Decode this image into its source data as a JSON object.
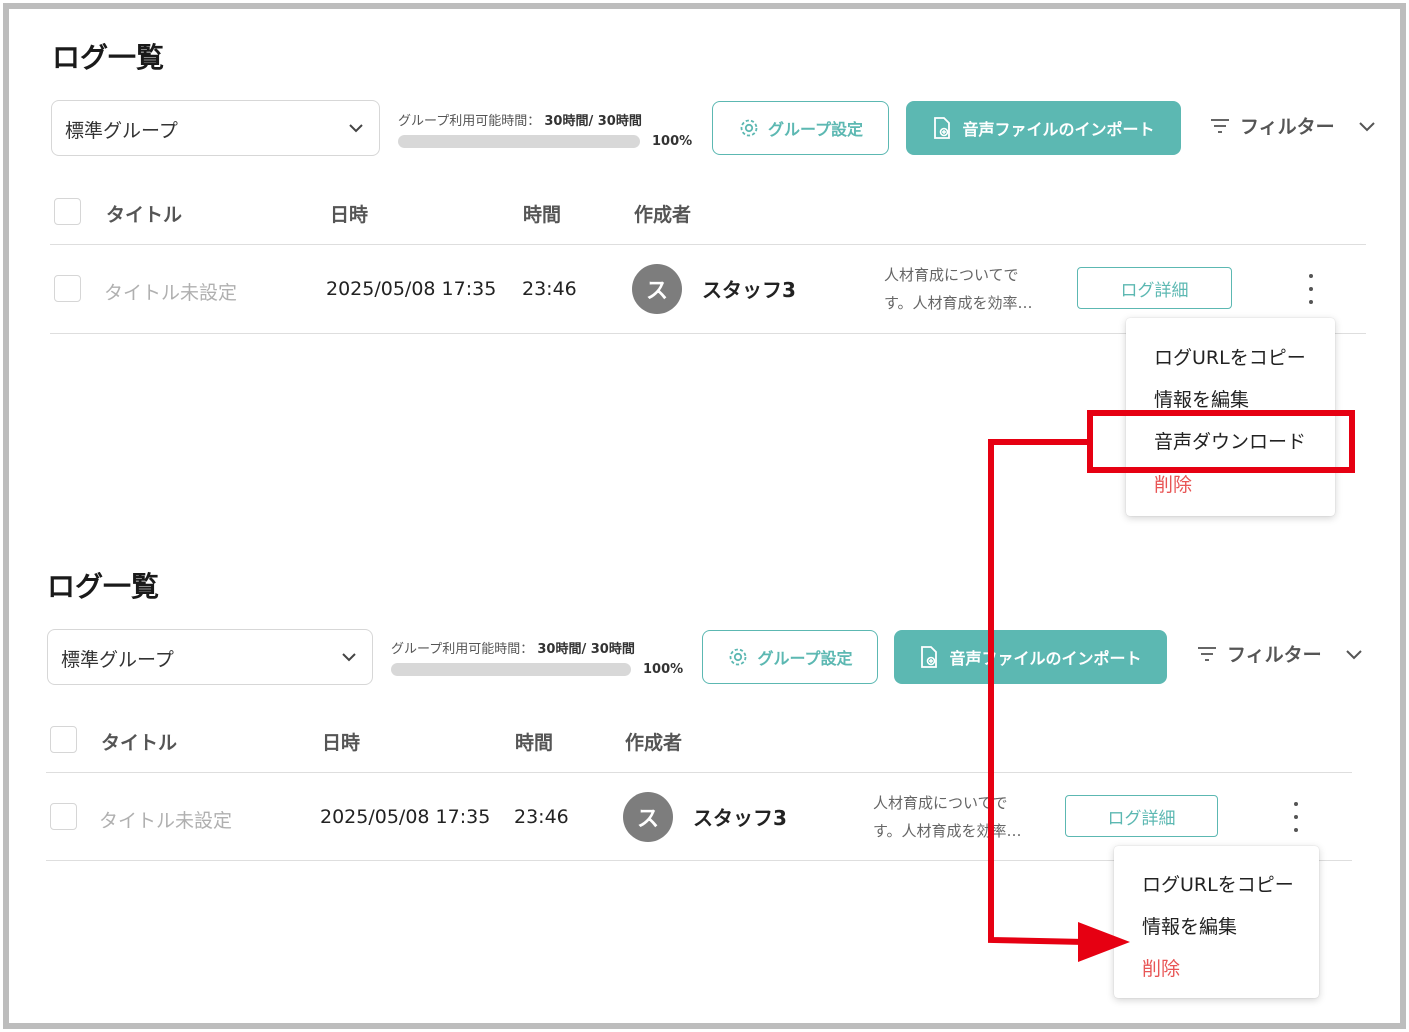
{
  "colors": {
    "accent": "#5cb8b2",
    "danger": "#e85555",
    "annotation": "#e60012",
    "avatar": "#7d7d7d"
  },
  "panels": [
    {
      "title": "ログ一覧",
      "group_select": "標準グループ",
      "usage_label": "グループ利用可能時間：",
      "usage_value": "30時間/ 30時間",
      "usage_percent": "100%",
      "usage_fraction": 1.0,
      "group_settings_button": "グループ設定",
      "import_button": "音声ファイルのインポート",
      "filter_label": "フィルター",
      "columns": [
        "タイトル",
        "日時",
        "時間",
        "作成者"
      ],
      "row": {
        "title": "タイトル未設定",
        "datetime": "2025/05/08 17:35",
        "duration": "23:46",
        "avatar_initial": "ス",
        "author": "スタッフ3",
        "description_line1": "人材育成についてで",
        "description_line2": "す。人材育成を効率…",
        "detail_button": "ログ詳細"
      },
      "menu": [
        "ログURLをコピー",
        "情報を編集",
        "音声ダウンロード",
        "削除"
      ]
    },
    {
      "title": "ログ一覧",
      "group_select": "標準グループ",
      "usage_label": "グループ利用可能時間：",
      "usage_value": "30時間/ 30時間",
      "usage_percent": "100%",
      "usage_fraction": 1.0,
      "group_settings_button": "グループ設定",
      "import_button": "音声ファイルのインポート",
      "filter_label": "フィルター",
      "columns": [
        "タイトル",
        "日時",
        "時間",
        "作成者"
      ],
      "row": {
        "title": "タイトル未設定",
        "datetime": "2025/05/08 17:35",
        "duration": "23:46",
        "avatar_initial": "ス",
        "author": "スタッフ3",
        "description_line1": "人材育成についてで",
        "description_line2": "す。人材育成を効率…",
        "detail_button": "ログ詳細"
      },
      "menu": [
        "ログURLをコピー",
        "情報を編集",
        "削除"
      ]
    }
  ]
}
